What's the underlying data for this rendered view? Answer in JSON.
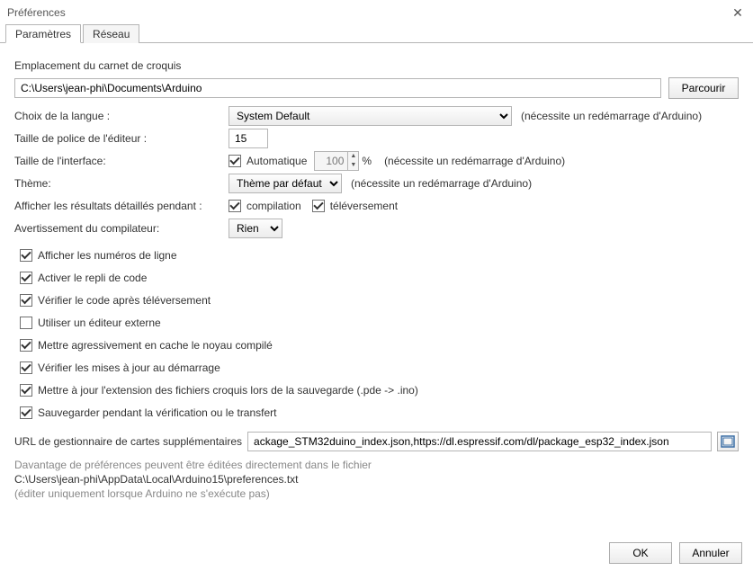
{
  "window": {
    "title": "Préférences"
  },
  "tabs": {
    "params": "Paramètres",
    "network": "Réseau"
  },
  "sketchbook": {
    "label": "Emplacement du carnet de croquis",
    "path": "C:\\Users\\jean-phi\\Documents\\Arduino",
    "browse": "Parcourir"
  },
  "language": {
    "label": "Choix de la langue :",
    "value": "System Default",
    "note": "(nécessite un redémarrage d'Arduino)"
  },
  "fontsize": {
    "label": "Taille de police de l'éditeur :",
    "value": "15"
  },
  "scale": {
    "label": "Taille de l'interface:",
    "auto_label": "Automatique",
    "value": "100",
    "percent": "%",
    "note": "(nécessite un redémarrage d'Arduino)"
  },
  "theme": {
    "label": "Thème:",
    "value": "Thème par défaut",
    "note": "(nécessite un redémarrage d'Arduino)"
  },
  "verbose": {
    "label": "Afficher les résultats détaillés pendant :",
    "compile": "compilation",
    "upload": "téléversement"
  },
  "warnings": {
    "label": "Avertissement du compilateur:",
    "value": "Rien"
  },
  "checks": {
    "line_numbers": "Afficher les numéros de ligne",
    "code_folding": "Activer le repli de code",
    "verify_after_upload": "Vérifier le code après téléversement",
    "external_editor": "Utiliser un éditeur externe",
    "cache_core": "Mettre agressivement en cache le noyau compilé",
    "check_updates": "Vérifier les mises à jour au démarrage",
    "update_ext": "Mettre à jour  l'extension des fichiers croquis lors de la sauvegarde (.pde -> .ino)",
    "save_on_verify": "Sauvegarder pendant la vérification ou le transfert"
  },
  "boards_url": {
    "label": "URL de gestionnaire de cartes supplémentaires",
    "value": "ackage_STM32duino_index.json,https://dl.espressif.com/dl/package_esp32_index.json"
  },
  "more_prefs": {
    "hint": "Davantage de préférences peuvent être éditées directement dans le fichier",
    "path": "C:\\Users\\jean-phi\\AppData\\Local\\Arduino15\\preferences.txt",
    "note": "(éditer uniquement lorsque Arduino ne s'exécute pas)"
  },
  "buttons": {
    "ok": "OK",
    "cancel": "Annuler"
  }
}
